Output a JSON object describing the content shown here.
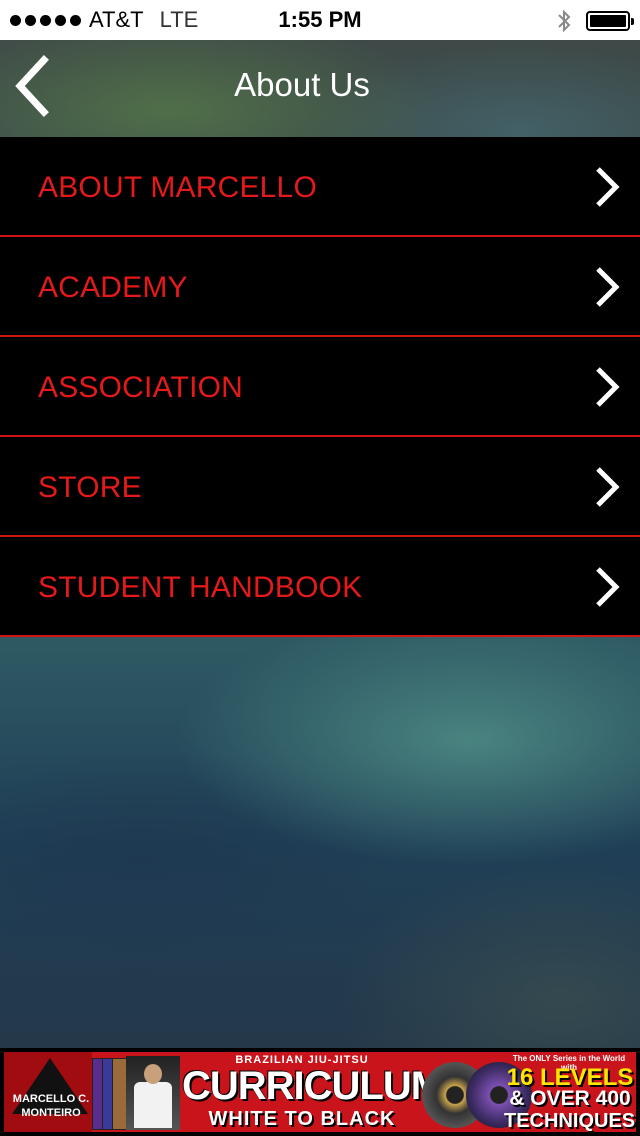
{
  "status_bar": {
    "carrier": "AT&T",
    "network": "LTE",
    "time": "1:55 PM"
  },
  "nav": {
    "title": "About Us",
    "back_icon": "chevron-left-icon"
  },
  "menu": {
    "items": [
      {
        "label": "ABOUT MARCELLO"
      },
      {
        "label": "ACADEMY"
      },
      {
        "label": "ASSOCIATION"
      },
      {
        "label": "STORE"
      },
      {
        "label": "STUDENT HANDBOOK"
      }
    ],
    "row_icon": "chevron-right-icon"
  },
  "banner": {
    "brand_name_line1": "MARCELLO C.",
    "brand_name_line2": "MONTEIRO",
    "small_caption": "BRAZILIAN JIU-JITSU",
    "headline": "CURRICULUM",
    "subline": "WHITE TO BLACK",
    "tiny_caption": "The ONLY Series in the World with",
    "levels": "16 LEVELS",
    "over": "& OVER 400",
    "techniques": "TECHNIQUES!"
  },
  "colors": {
    "menu_text": "#e41a1a",
    "menu_divider": "#d01414",
    "menu_bg": "#000000",
    "banner_bg": "#c8141a"
  }
}
